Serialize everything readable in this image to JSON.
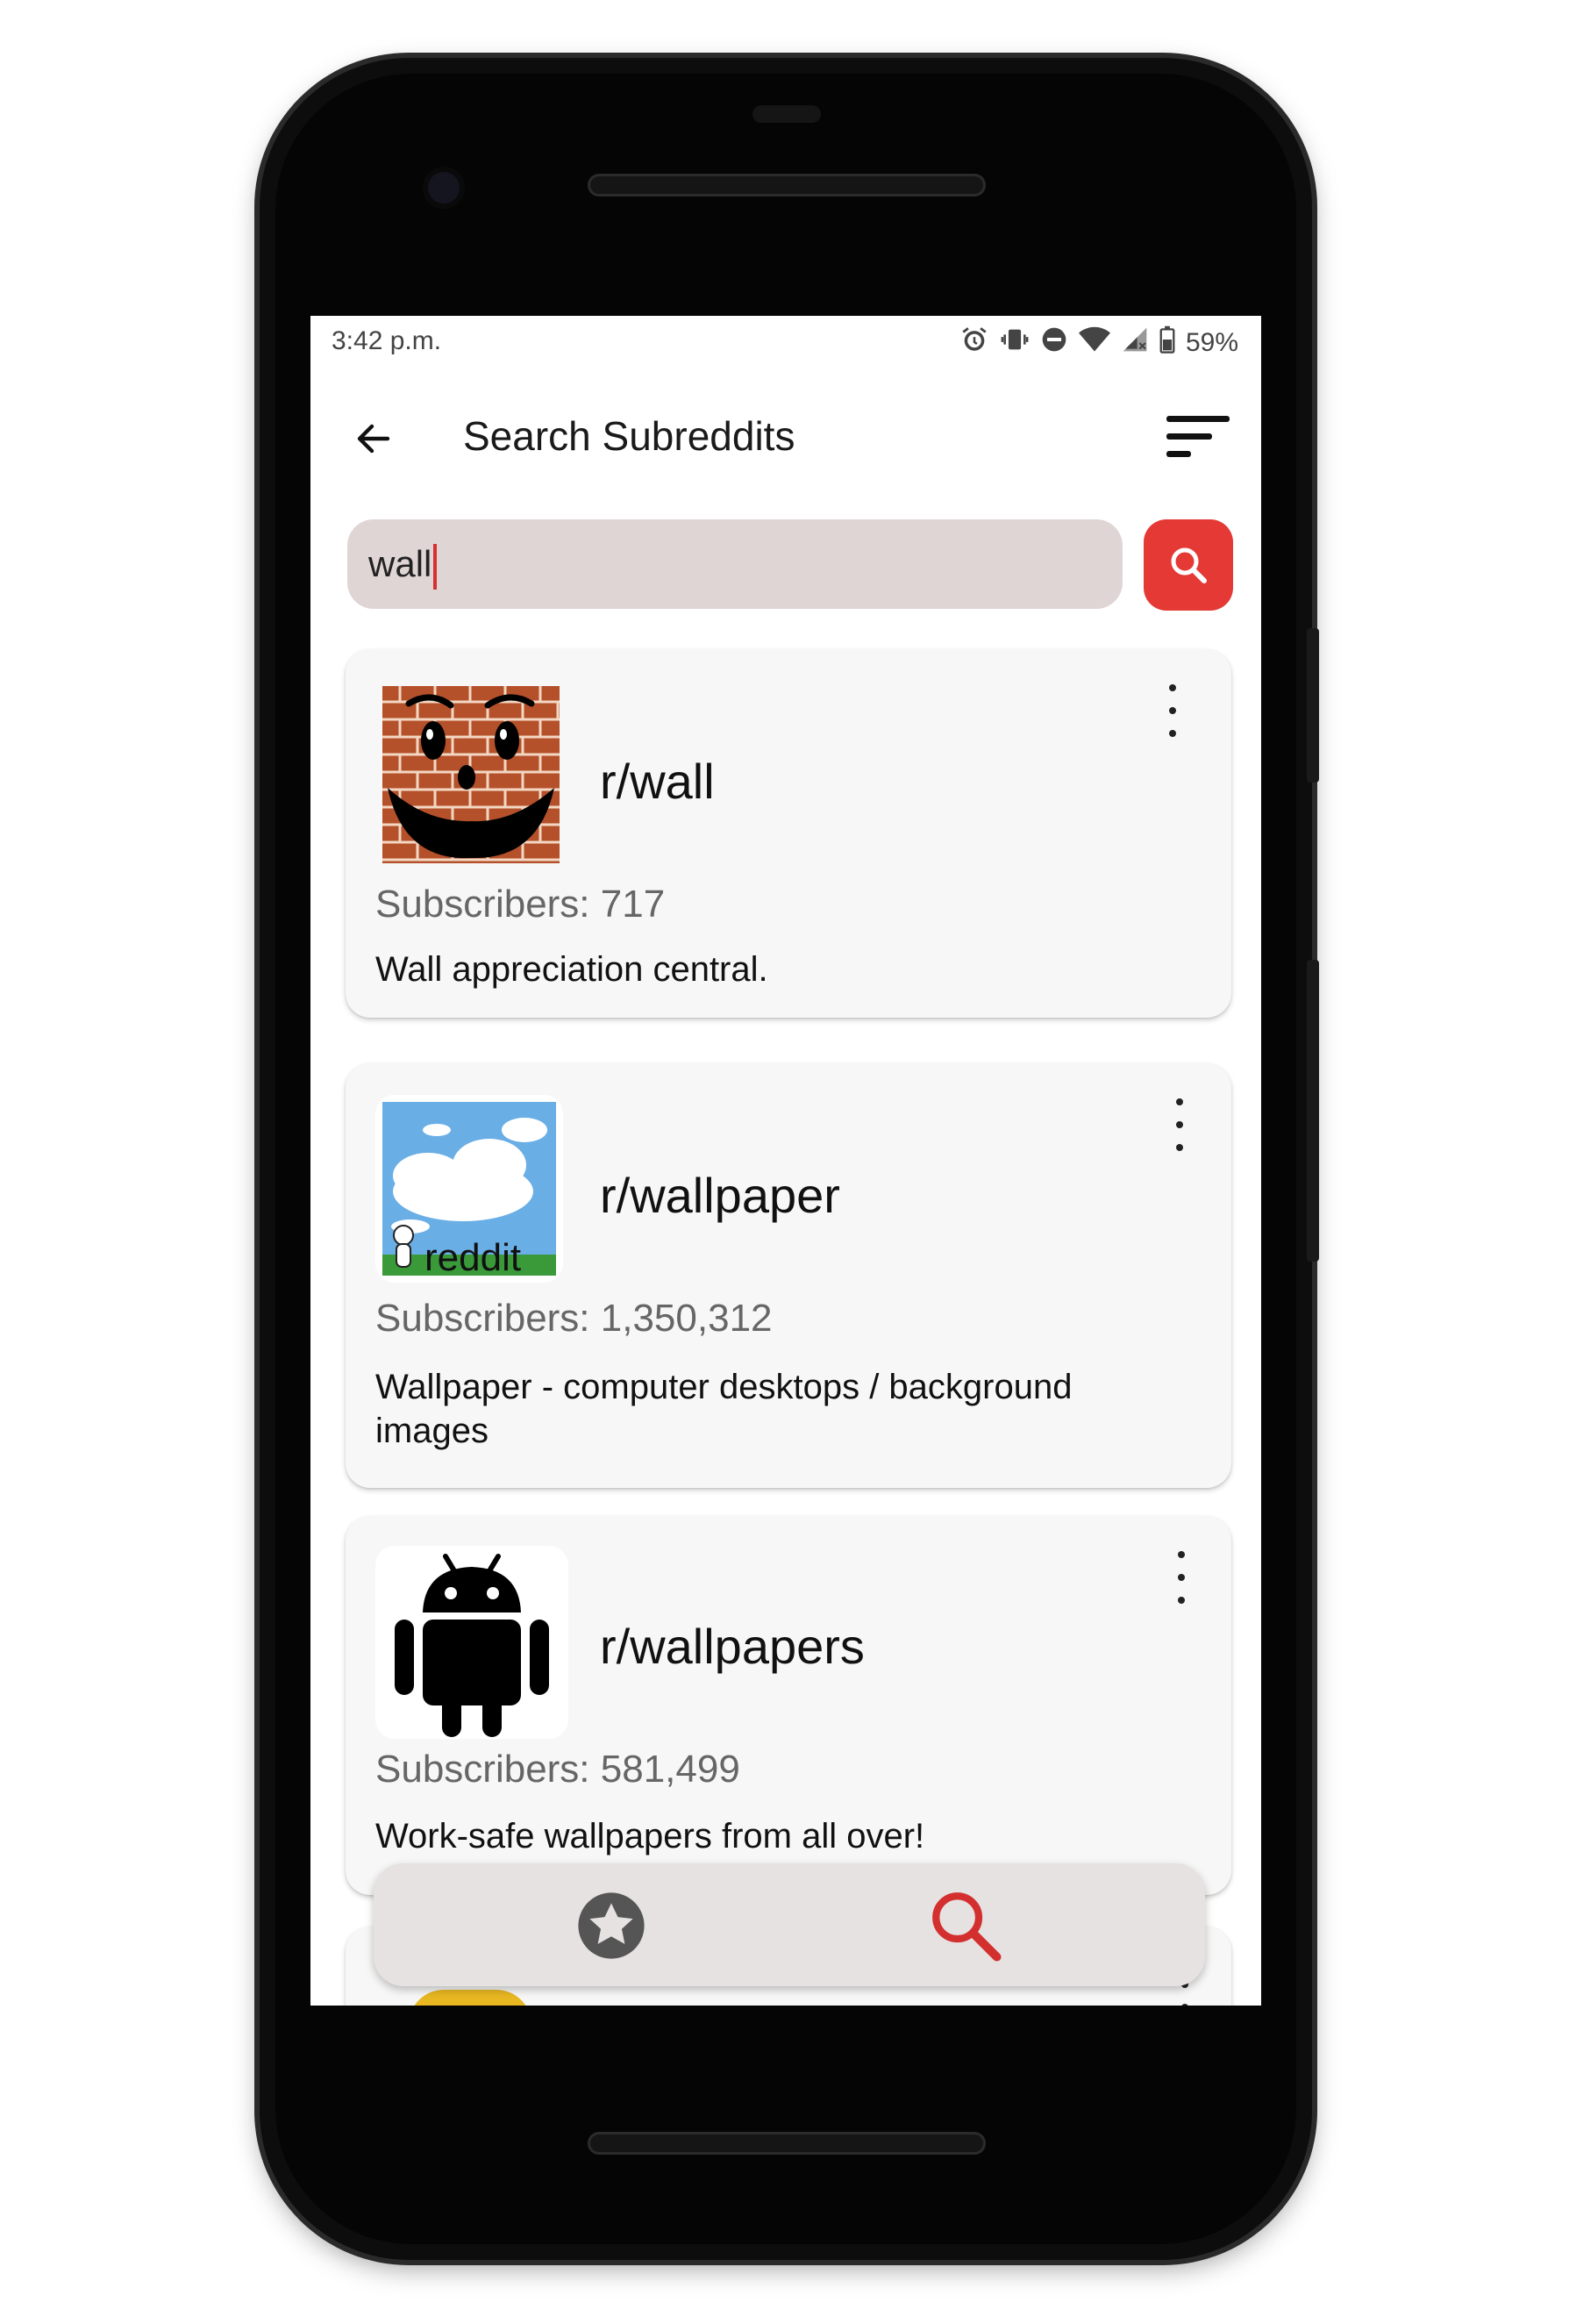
{
  "status_bar": {
    "time": "3:42 p.m.",
    "battery_percent": "59%"
  },
  "app_bar": {
    "title": "Search Subreddits"
  },
  "search": {
    "value": "wall"
  },
  "results": [
    {
      "name": "r/wall",
      "subscribers": "Subscribers: 717",
      "description": "Wall appreciation central."
    },
    {
      "name": "r/wallpaper",
      "subscribers": "Subscribers: 1,350,312",
      "description": "Wallpaper - computer desktops / background images",
      "thumb_text": "reddit"
    },
    {
      "name": "r/wallpapers",
      "subscribers": "Subscribers: 581,499",
      "description": "Work-safe wallpapers from all over!"
    }
  ],
  "bottom_nav": {
    "items": [
      "star-icon",
      "search-icon"
    ],
    "active": "search-icon"
  },
  "colors": {
    "accent": "#e53935",
    "search_bg": "#e0d5d5",
    "card_bg": "#f7f7f7",
    "nav_bg": "#e6e2e1"
  }
}
